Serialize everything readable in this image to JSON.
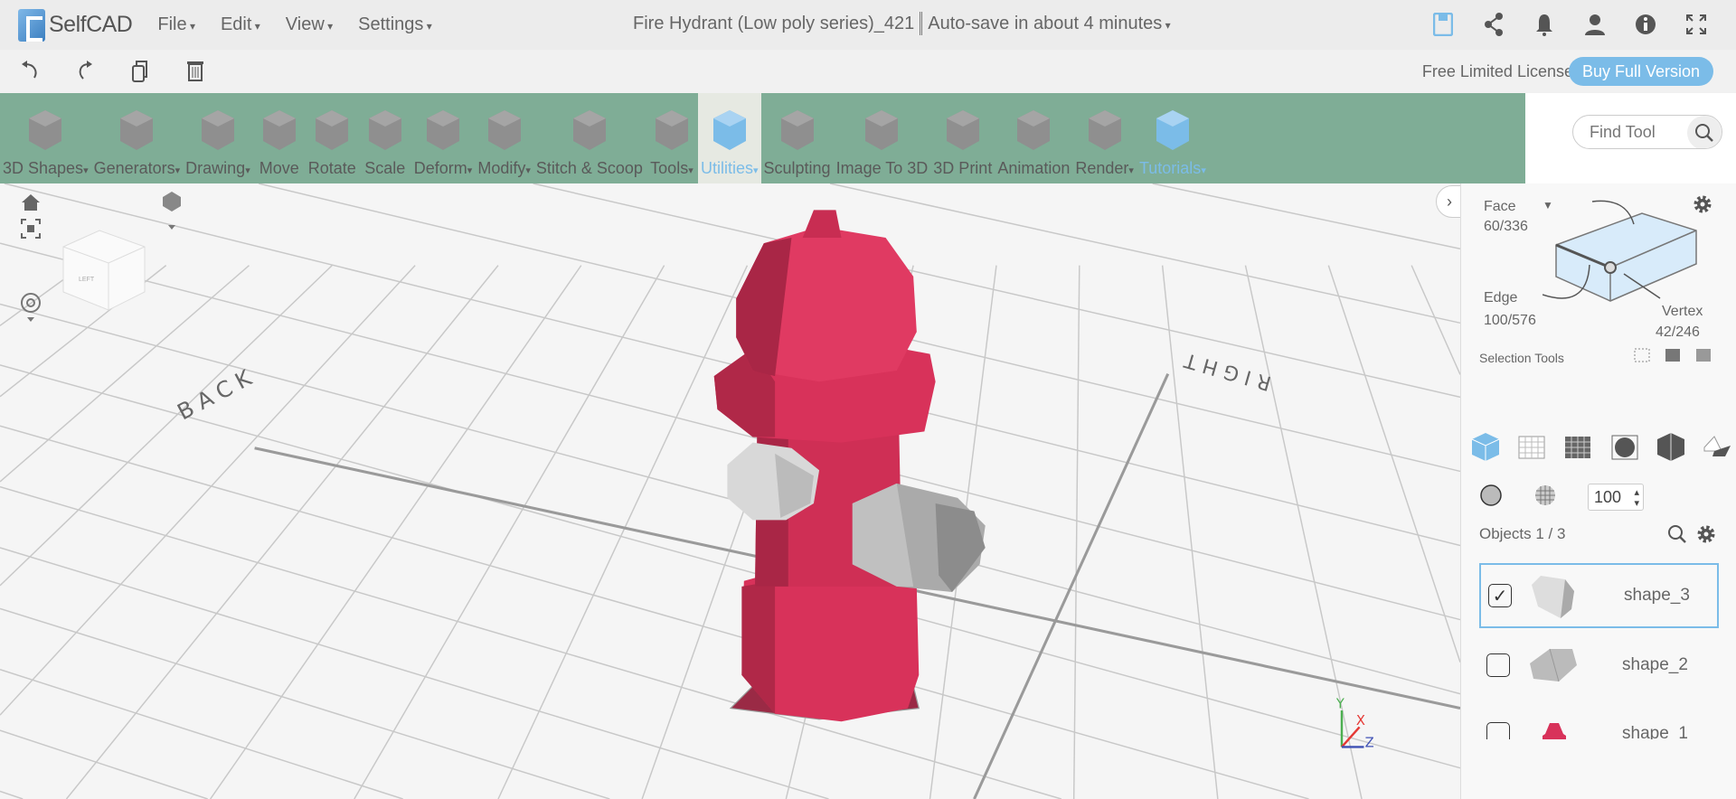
{
  "app": {
    "name": "SelfCAD"
  },
  "menu": [
    "File",
    "Edit",
    "View",
    "Settings"
  ],
  "document": {
    "title": "Fire Hydrant (Low poly series)_421",
    "autosave": "Auto-save in about 4 minutes"
  },
  "topicons": [
    "save-icon",
    "share-icon",
    "bell-icon",
    "user-icon",
    "info-icon",
    "fullscreen-icon"
  ],
  "license": {
    "text": "Free Limited License",
    "buy_label": "Buy Full Version"
  },
  "ribbon": [
    {
      "label": "3D Shapes",
      "dropdown": true
    },
    {
      "label": "Generators",
      "dropdown": true
    },
    {
      "label": "Drawing",
      "dropdown": true
    },
    {
      "label": "Move",
      "dropdown": false
    },
    {
      "label": "Rotate",
      "dropdown": false
    },
    {
      "label": "Scale",
      "dropdown": false
    },
    {
      "label": "Deform",
      "dropdown": true
    },
    {
      "label": "Modify",
      "dropdown": true
    },
    {
      "label": "Stitch & Scoop",
      "dropdown": false
    },
    {
      "label": "Tools",
      "dropdown": true
    },
    {
      "label": "Utilities",
      "dropdown": true,
      "active": true
    },
    {
      "label": "Sculpting",
      "dropdown": false
    },
    {
      "label": "Image To 3D",
      "dropdown": false
    },
    {
      "label": "3D Print",
      "dropdown": false
    },
    {
      "label": "Animation",
      "dropdown": false
    },
    {
      "label": "Render",
      "dropdown": true
    },
    {
      "label": "Tutorials",
      "dropdown": true
    }
  ],
  "find_tool": {
    "placeholder": "Find Tool"
  },
  "viewport": {
    "labels": {
      "back": "BACK",
      "right": "RIGHT",
      "cube_face": "LEFT"
    },
    "axes": {
      "y": "Y",
      "x": "X",
      "z": "Z"
    },
    "hydrant_color": "#d8325a"
  },
  "panel": {
    "face": {
      "label": "Face",
      "count": "60/336"
    },
    "edge": {
      "label": "Edge",
      "count": "100/576"
    },
    "vertex": {
      "label": "Vertex",
      "count": "42/246"
    },
    "selection_tools": "Selection Tools",
    "brush_size": "100",
    "objects_title": "Objects 1 / 3",
    "objects": [
      {
        "name": "shape_3",
        "checked": true
      },
      {
        "name": "shape_2",
        "checked": false
      },
      {
        "name": "shape_1",
        "checked": false
      }
    ]
  },
  "colors": {
    "accent": "#7bbce8",
    "ribbon": "#7fad96"
  }
}
